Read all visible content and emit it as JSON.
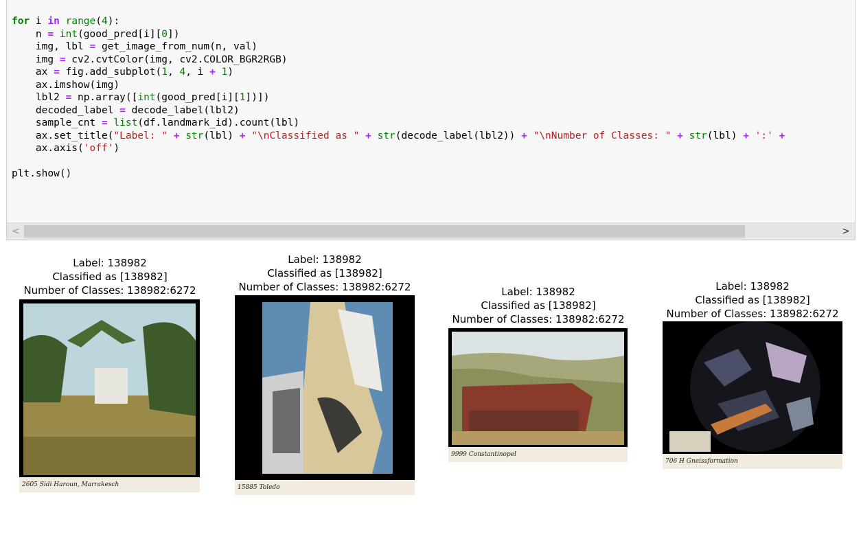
{
  "code_cell": {
    "lines": [
      "for i in range(4):",
      "    n = int(good_pred[i][0])",
      "    img, lbl = get_image_from_num(n, val)",
      "    img = cv2.cvtColor(img, cv2.COLOR_BGR2RGB)",
      "    ax = fig.add_subplot(1, 4, i + 1)",
      "    ax.imshow(img)",
      "    lbl2 = np.array([int(good_pred[i][1])])",
      "    decoded_label = decode_label(lbl2)",
      "    sample_cnt = list(df.landmark_id).count(lbl)",
      "    ax.set_title(\"Label: \" + str(lbl) + \"\\nClassified as \" + str(decode_label(lbl2)) + \"\\nNumber of Classes: \" + str(lbl) + ':' +",
      "    ax.axis('off')",
      "",
      "plt.show()"
    ],
    "scroll_left_icon": "chevron-left",
    "scroll_right_icon": "chevron-right",
    "scroll_left_glyph": "<",
    "scroll_right_glyph": ">"
  },
  "output": {
    "panels": [
      {
        "title_line1": "Label: 138982",
        "title_line2": "Classified as [138982]",
        "title_line3": "Number of Classes: 138982:6272",
        "caption": "2605 Sidi Haroun, Marrakesch",
        "colors": {
          "sky": "#bcd6dc",
          "foliage": "#3f5a2a",
          "ground": "#9a8a4a"
        }
      },
      {
        "title_line1": "Label: 138982",
        "title_line2": "Classified as [138982]",
        "title_line3": "Number of Classes: 138982:6272",
        "caption": "15885 Toledo",
        "colors": {
          "sky": "#5f8cb3",
          "wall": "#d8c79a",
          "shadow": "#6b6a6c"
        }
      },
      {
        "title_line1": "Label: 138982",
        "title_line2": "Classified as [138982]",
        "title_line3": "Number of Classes: 138982:6272",
        "caption": "9999 Constantinopel",
        "colors": {
          "sky": "#dbe2e4",
          "hills": "#8b8f5a",
          "roof": "#8a3a2a"
        }
      },
      {
        "title_line1": "Label: 138982",
        "title_line2": "Classified as [138982]",
        "title_line3": "Number of Classes: 138982:6272",
        "caption": "706 H Gneissformation",
        "colors": {
          "disc": "#15161c",
          "grains": "#b9a6c4",
          "accent": "#c87a3a"
        }
      }
    ]
  }
}
